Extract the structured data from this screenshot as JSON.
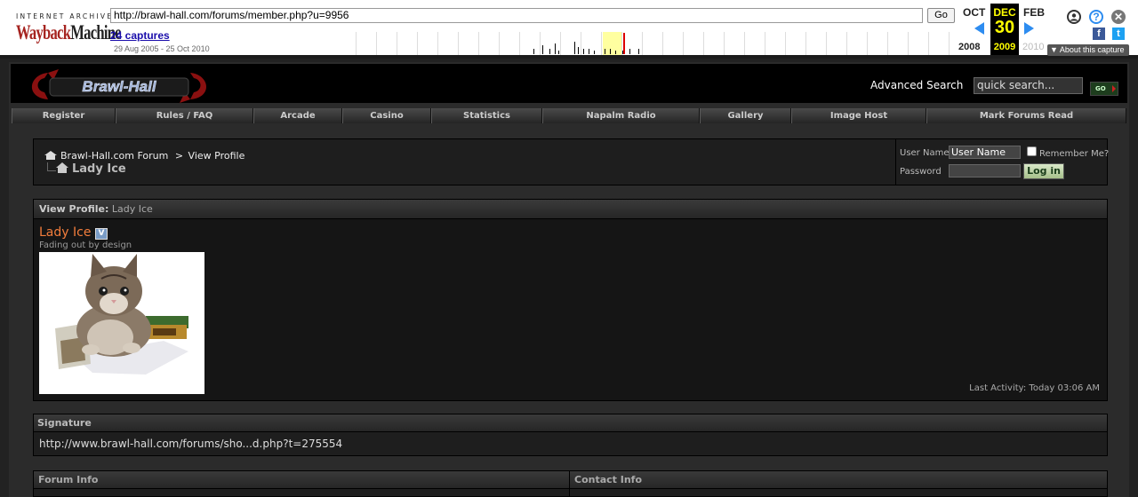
{
  "wayback": {
    "logo_top": "INTERNET ARCHIVE",
    "logo_main_a": "Wayback",
    "logo_main_b": "Machine",
    "url": "http://brawl-hall.com/forums/member.php?u=9956",
    "go_label": "Go",
    "captures": "24 captures",
    "date_range": "29 Aug 2005 - 25 Oct 2010",
    "prev_month": "OCT",
    "cur_month": "DEC",
    "next_month": "FEB",
    "cur_day": "30",
    "prev_year": "2008",
    "cur_year": "2009",
    "next_year": "2010",
    "about": "About this capture",
    "user_icon": "user-icon",
    "help_icon": "help-icon",
    "close_icon": "close-icon",
    "help_glyph": "?",
    "close_glyph": "✕",
    "fb_glyph": "f",
    "tw_glyph": "t",
    "highlight_color": "#ffffa0",
    "arrow_color": "#2d8cf0"
  },
  "site": {
    "logo_text": "Brawl-Hall",
    "advanced_search": "Advanced Search",
    "quick_search_placeholder": "quick search...",
    "go_label": "GO"
  },
  "nav": [
    {
      "label": "Register"
    },
    {
      "label": "Rules / FAQ"
    },
    {
      "label": "Arcade"
    },
    {
      "label": "Casino"
    },
    {
      "label": "Statistics"
    },
    {
      "label": "Napalm Radio"
    },
    {
      "label": "Gallery"
    },
    {
      "label": "Image Host"
    },
    {
      "label": "Mark Forums Read"
    }
  ],
  "breadcrumb": {
    "forum": "Brawl-Hall.com Forum",
    "separator": ">",
    "current": "View Profile",
    "page_name": "Lady Ice"
  },
  "login": {
    "username_label": "User Name",
    "username_value": "User Name",
    "remember_label": "Remember Me?",
    "password_label": "Password",
    "login_button": "Log in"
  },
  "profile": {
    "header_label": "View Profile",
    "header_name": "Lady Ice",
    "name": "Lady Ice",
    "badge": "V",
    "user_title": "Fading out by design",
    "last_activity_label": "Last Activity:",
    "last_activity_value": "Today 03:06 AM",
    "name_color": "#f27d3c"
  },
  "signature": {
    "header": "Signature",
    "text": "http://www.brawl-hall.com/forums/sho...d.php?t=275554"
  },
  "info": {
    "forum_info": "Forum Info",
    "contact_info": "Contact Info"
  }
}
